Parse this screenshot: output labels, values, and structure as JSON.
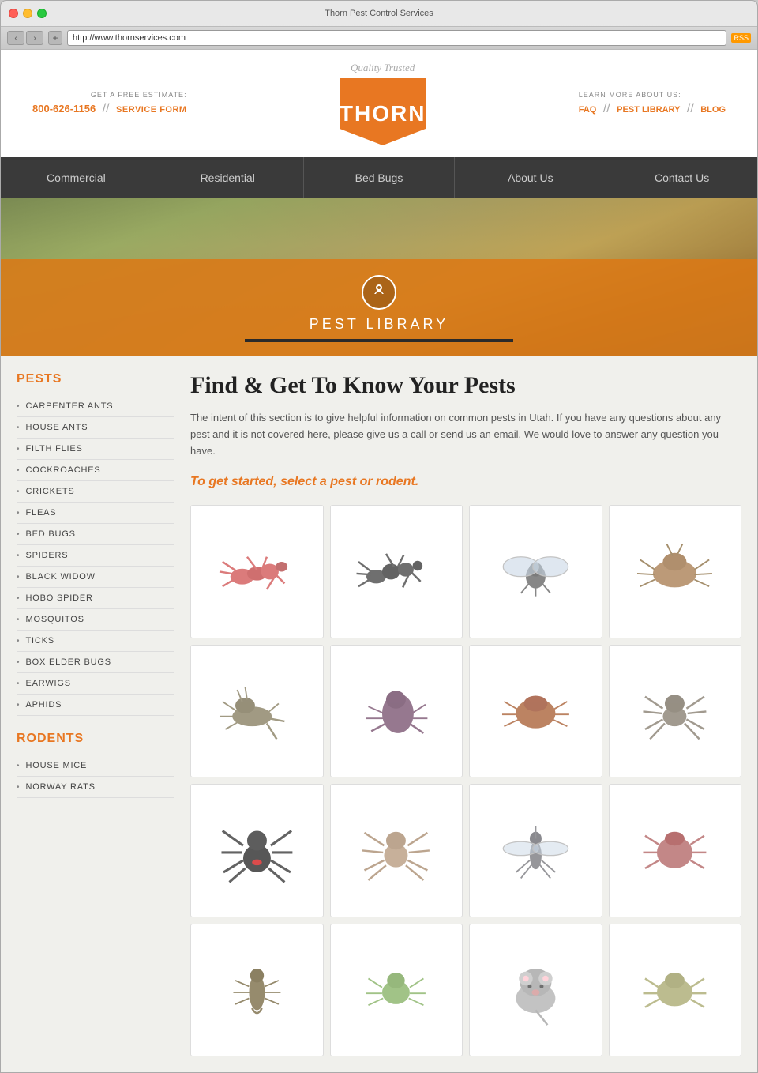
{
  "browser": {
    "title": "Thorn Pest Control Services",
    "url": "http://www.thornservices.com",
    "rss": "RSS"
  },
  "header": {
    "left_label": "GET A FREE ESTIMATE:",
    "phone": "800-626-1156",
    "sep1": "//",
    "service_form": "SERVICE FORM",
    "right_label": "LEARN MORE ABOUT US:",
    "faq": "FAQ",
    "sep2": "//",
    "pest_library": "PEST LIBRARY",
    "sep3": "//",
    "blog": "BLOG",
    "tagline": "Quality Trusted",
    "logo": "THORN"
  },
  "nav": {
    "items": [
      {
        "label": "Commercial"
      },
      {
        "label": "Residential"
      },
      {
        "label": "Bed Bugs"
      },
      {
        "label": "About Us"
      },
      {
        "label": "Contact Us"
      }
    ]
  },
  "hero": {
    "title": "PEST LIBRARY"
  },
  "sidebar": {
    "pests_title": "PESTS",
    "pests": [
      {
        "label": "CARPENTER ANTS"
      },
      {
        "label": "HOUSE ANTS"
      },
      {
        "label": "FILTH FLIES"
      },
      {
        "label": "COCKROACHES"
      },
      {
        "label": "CRICKETS"
      },
      {
        "label": "FLEAS"
      },
      {
        "label": "BED BUGS"
      },
      {
        "label": "SPIDERS"
      },
      {
        "label": "BLACK WIDOW"
      },
      {
        "label": "HOBO SPIDER"
      },
      {
        "label": "MOSQUITOS"
      },
      {
        "label": "TICKS"
      },
      {
        "label": "BOX ELDER BUGS"
      },
      {
        "label": "EARWIGS"
      },
      {
        "label": "APHIDS"
      }
    ],
    "rodents_title": "RODENTS",
    "rodents": [
      {
        "label": "HOUSE MICE"
      },
      {
        "label": "NORWAY RATS"
      }
    ]
  },
  "main": {
    "title": "Find & Get To Know Your Pests",
    "description": "The intent of this section is to give helpful information on common pests in Utah. If you have any questions about any pest and it is not covered here, please give us a call or send us an email. We would love to answer any question you have.",
    "cta": "To get started, select a pest or rodent.",
    "grid": [
      {
        "name": "carpenter-ant",
        "color": "#c44"
      },
      {
        "name": "house-ant",
        "color": "#333"
      },
      {
        "name": "filth-fly",
        "color": "#666"
      },
      {
        "name": "cockroach",
        "color": "#a85"
      },
      {
        "name": "cricket",
        "color": "#775"
      },
      {
        "name": "flea",
        "color": "#856"
      },
      {
        "name": "bed-bug",
        "color": "#a63"
      },
      {
        "name": "hobo-spider",
        "color": "#666"
      },
      {
        "name": "black-widow",
        "color": "#111"
      },
      {
        "name": "spider",
        "color": "#a97"
      },
      {
        "name": "mosquito",
        "color": "#888"
      },
      {
        "name": "tick",
        "color": "#a55"
      },
      {
        "name": "earwig",
        "color": "#664"
      },
      {
        "name": "aphid",
        "color": "#7a5"
      },
      {
        "name": "mouse",
        "color": "#aaa"
      }
    ]
  }
}
